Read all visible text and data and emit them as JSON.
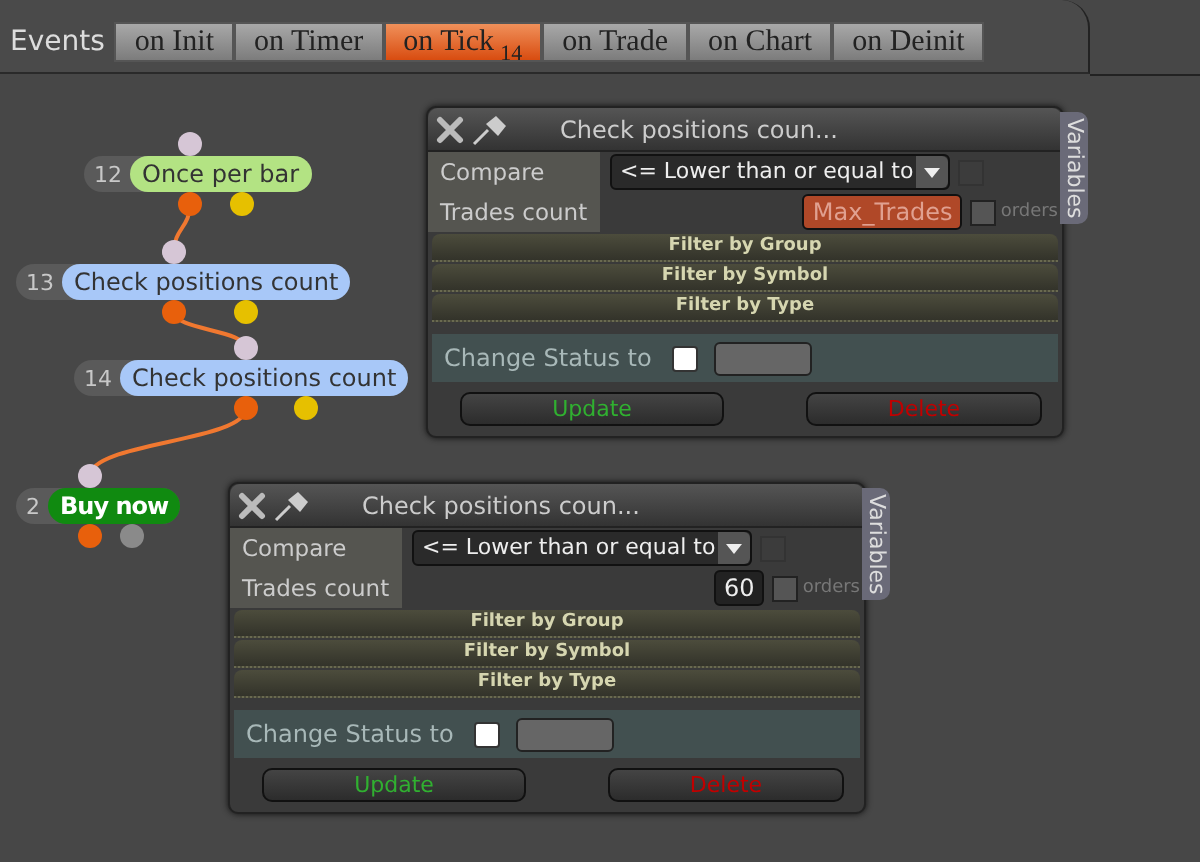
{
  "events_label": "Events",
  "tabs": [
    {
      "label": "on Init",
      "selected": false
    },
    {
      "label": "on Timer",
      "selected": false
    },
    {
      "label": "on Tick",
      "selected": true,
      "badge": "14"
    },
    {
      "label": "on Trade",
      "selected": false
    },
    {
      "label": "on Chart",
      "selected": false
    },
    {
      "label": "on Deinit",
      "selected": false
    }
  ],
  "nodes": [
    {
      "number": "12",
      "label": "Once per bar",
      "color": "#b3e383",
      "kind": "condition"
    },
    {
      "number": "13",
      "label": "Check positions count",
      "color": "#a8c8f8",
      "kind": "condition"
    },
    {
      "number": "14",
      "label": "Check positions count",
      "color": "#a8c8f8",
      "kind": "condition"
    },
    {
      "number": "2",
      "label": "Buy now",
      "color": "#108a10",
      "kind": "action"
    }
  ],
  "panels": [
    {
      "title": "Check positions coun...",
      "side_tab": "Variables",
      "compare_label": "Compare",
      "compare_value": "<= Lower than or equal to",
      "compare_option": {
        "checked": false,
        "disabled": true
      },
      "count_label": "Trades count",
      "count_field": {
        "value": "Max_Trades",
        "kind": "variable"
      },
      "orders_label": "orders",
      "orders_checked": false,
      "filters": [
        "Filter by Group",
        "Filter by Symbol",
        "Filter by Type"
      ],
      "status_label": "Change Status to",
      "status_checked": false,
      "update_label": "Update",
      "delete_label": "Delete"
    },
    {
      "title": "Check positions coun...",
      "side_tab": "Variables",
      "compare_label": "Compare",
      "compare_value": "<= Lower than or equal to",
      "compare_option": {
        "checked": false,
        "disabled": true
      },
      "count_label": "Trades count",
      "count_field": {
        "value": "60",
        "kind": "number"
      },
      "orders_label": "orders",
      "orders_checked": false,
      "filters": [
        "Filter by Group",
        "Filter by Symbol",
        "Filter by Type"
      ],
      "status_label": "Change Status to",
      "status_checked": false,
      "update_label": "Update",
      "delete_label": "Delete"
    }
  ]
}
